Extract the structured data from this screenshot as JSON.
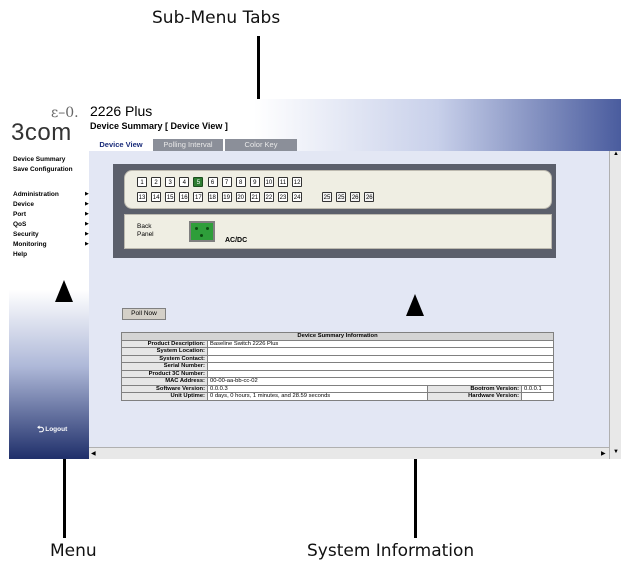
{
  "callouts": {
    "top": "Sub-Menu Tabs",
    "bottom_left": "Menu",
    "bottom_right": "System Information"
  },
  "header": {
    "logo": "3com",
    "product_title": "2226 Plus",
    "page_subtitle": "Device Summary [ Device View ]"
  },
  "tabs": [
    {
      "label": "Device View",
      "active": true
    },
    {
      "label": "Polling Interval",
      "active": false
    },
    {
      "label": "Color Key",
      "active": false
    }
  ],
  "sidebar": {
    "top_items": [
      "Device Summary",
      "Save Configuration"
    ],
    "menu_items": [
      "Administration",
      "Device",
      "Port",
      "QoS",
      "Security",
      "Monitoring",
      "Help"
    ],
    "logout": "Logout"
  },
  "device_view": {
    "ports_row1": [
      "1",
      "2",
      "3",
      "4",
      "5",
      "6",
      "7",
      "8",
      "9",
      "10",
      "11",
      "12"
    ],
    "ports_row2": [
      "13",
      "14",
      "15",
      "16",
      "17",
      "18",
      "19",
      "20",
      "21",
      "22",
      "23",
      "24"
    ],
    "combo_ports": [
      "25",
      "25",
      "26",
      "26"
    ],
    "active_port": "5",
    "back_panel_label_1": "Back",
    "back_panel_label_2": "Panel",
    "power_label": "AC/DC"
  },
  "poll_button": "Poll Now",
  "summary": {
    "heading": "Device Summary Information",
    "rows": [
      {
        "label": "Product Description:",
        "value": "Baseline Switch 2226 Plus"
      },
      {
        "label": "System Location:",
        "value": ""
      },
      {
        "label": "System Contact:",
        "value": ""
      },
      {
        "label": "Serial Number:",
        "value": ""
      },
      {
        "label": "Product 3C Number:",
        "value": ""
      },
      {
        "label": "MAC Address:",
        "value": "00-00-aa-bb-cc-02"
      },
      {
        "label": "Software Version:",
        "value": "0.0.0.3",
        "label2": "Bootrom Version:",
        "value2": "0.0.0.1"
      },
      {
        "label": "Unit Uptime:",
        "value": "0 days, 0 hours, 1 minutes, and 28.59 seconds",
        "label2": "Hardware Version:",
        "value2": ""
      }
    ]
  },
  "colors": {
    "active_port": "#2e7d32",
    "header_gradient_end": "#4a5c9e",
    "panel_frame": "#5b5f6b"
  }
}
